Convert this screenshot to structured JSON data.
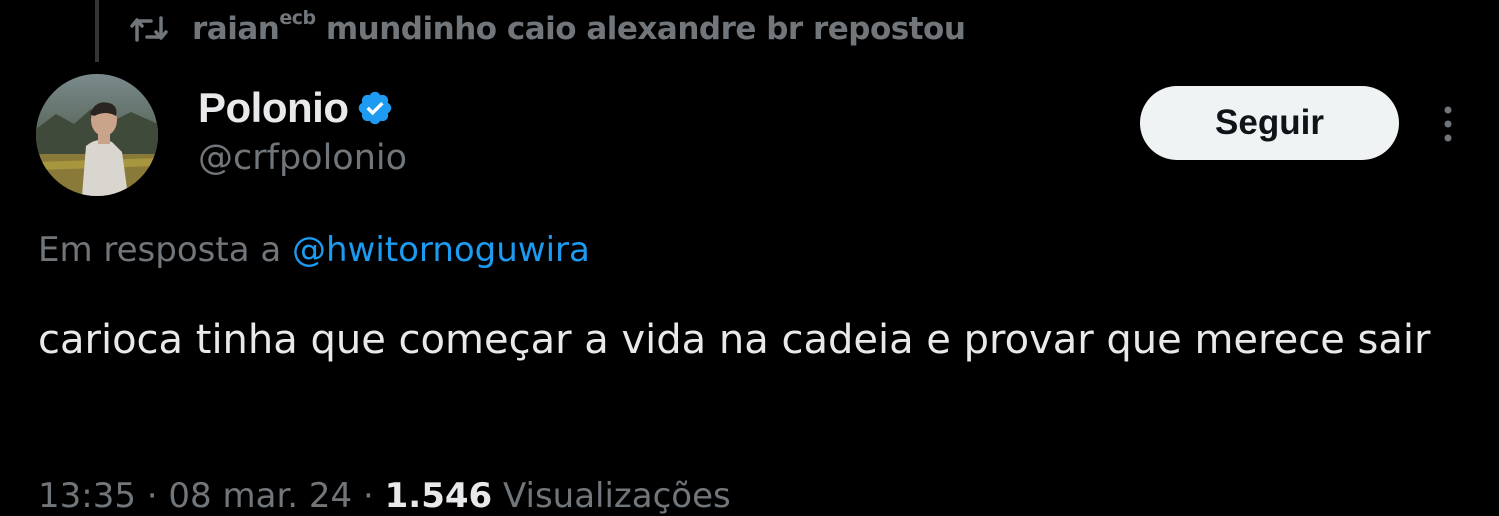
{
  "repost": {
    "icon": "repost-icon",
    "user_name": "raian",
    "user_sup": "ecb",
    "text": " mundinho caio alexandre br repostou"
  },
  "author": {
    "name": "Polonio",
    "handle": "@crfpolonio",
    "verified_icon": "verified-badge-icon",
    "verified_color": "#1d9bf0"
  },
  "follow_button": {
    "label": "Seguir"
  },
  "more_icon": "more-vertical-icon",
  "reply_context": {
    "prefix": "Em resposta a ",
    "mention": "@hwitornoguwira"
  },
  "tweet": {
    "text": "carioca tinha que começar a vida na cadeia e provar que merece sair"
  },
  "meta": {
    "time": "13:35",
    "separator_1": " · ",
    "date": "08 mar. 24",
    "separator_2": " · ",
    "views_count": "1.546",
    "views_label": " Visualizações"
  },
  "colors": {
    "background": "#000000",
    "primary_text": "#e7e9ea",
    "secondary_text": "#71767b",
    "accent": "#1d9bf0",
    "button_bg": "#eff3f4"
  }
}
